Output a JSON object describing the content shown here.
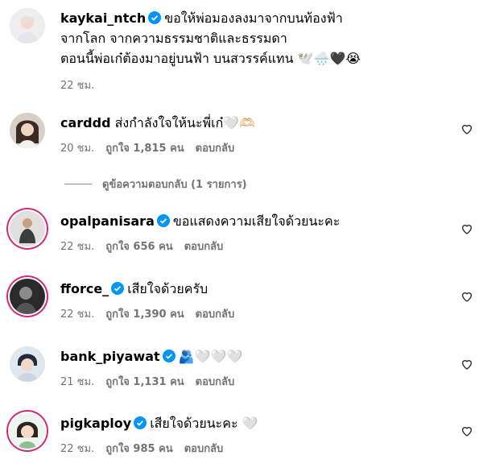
{
  "caption": {
    "username": "kaykai_ntch",
    "lines": [
      "ขอให้พ่อมองลงมาจากบนท้องฟ้า",
      "จากโลก จากความธรรมชาติและธรรมดา",
      "ตอนนี้พ่อเก๋ต้องมาอยู่บนฟ้า บนสวรรค์แทน 🕊️🌧️🖤😭"
    ],
    "time": "22 ชม."
  },
  "comments": [
    {
      "username": "carddd",
      "verified": false,
      "text": "ส่งกำลังใจให้นะพี่เก๋🤍🫶🏻",
      "time": "20 ชม.",
      "likes": "ถูกใจ 1,815 คน",
      "reply": "ตอบกลับ"
    },
    {
      "username": "opalpanisara",
      "verified": true,
      "text": "ขอแสดงความเสียใจด้วยนะคะ",
      "time": "22 ชม.",
      "likes": "ถูกใจ 656 คน",
      "reply": "ตอบกลับ"
    },
    {
      "username": "fforce_",
      "verified": true,
      "text": "เสียใจด้วยครับ",
      "time": "22 ชม.",
      "likes": "ถูกใจ 1,390 คน",
      "reply": "ตอบกลับ"
    },
    {
      "username": "bank_piyawat",
      "verified": true,
      "text": "🫂🤍🤍🤍",
      "time": "21 ชม.",
      "likes": "ถูกใจ 1,131 คน",
      "reply": "ตอบกลับ"
    },
    {
      "username": "pigkaploy",
      "verified": true,
      "text": "เสียใจด้วยนะคะ 🤍",
      "time": "22 ชม.",
      "likes": "ถูกใจ 985 คน",
      "reply": "ตอบกลับ"
    }
  ],
  "view_replies": "ดูข้อความตอบกลับ (1 รายการ)",
  "colors": {
    "verified": "#0095f6",
    "meta": "#737373",
    "story_ring": "#d62976"
  }
}
